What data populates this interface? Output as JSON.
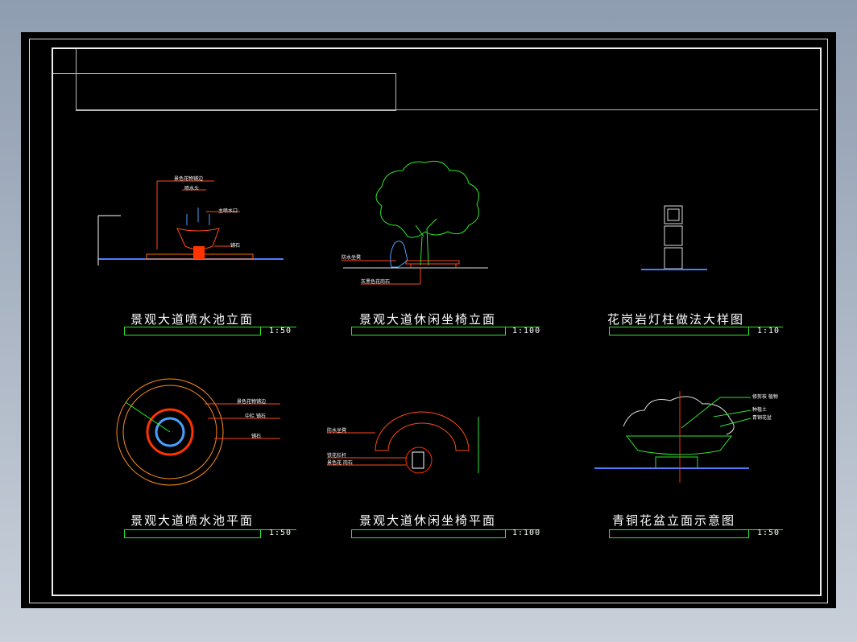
{
  "panels": [
    {
      "title": "景观大道喷水池立面",
      "scale": "1:50"
    },
    {
      "title": "景观大道休闲坐椅立面",
      "scale": "1:100"
    },
    {
      "title": "花岗岩灯柱做法大样图",
      "scale": "1:10"
    },
    {
      "title": "景观大道喷水池平面",
      "scale": "1:50"
    },
    {
      "title": "景观大道休闲坐椅平面",
      "scale": "1:100"
    },
    {
      "title": "青铜花盆立面示意图",
      "scale": "1:50"
    }
  ],
  "annotations": {
    "fountain_elev": [
      "景色花物铺边",
      "喷水头",
      "主喷水口",
      "铺石"
    ],
    "bench_elev": [
      "防水坐凳",
      "灰黑色花岗石"
    ],
    "fountain_plan": [
      "景色花物铺边",
      "中栏 铺石",
      "铺石"
    ],
    "bench_plan": [
      "防水坐凳",
      "铁花栏杆",
      "景色花 岗石"
    ],
    "bronze_pot": [
      "修剪枝 植物",
      "种植土",
      "青铜花盆"
    ]
  },
  "colors": {
    "background": "#000000",
    "accent_green": "#2ee62e",
    "accent_red": "#ff3300",
    "frame": "#eeeeee"
  }
}
